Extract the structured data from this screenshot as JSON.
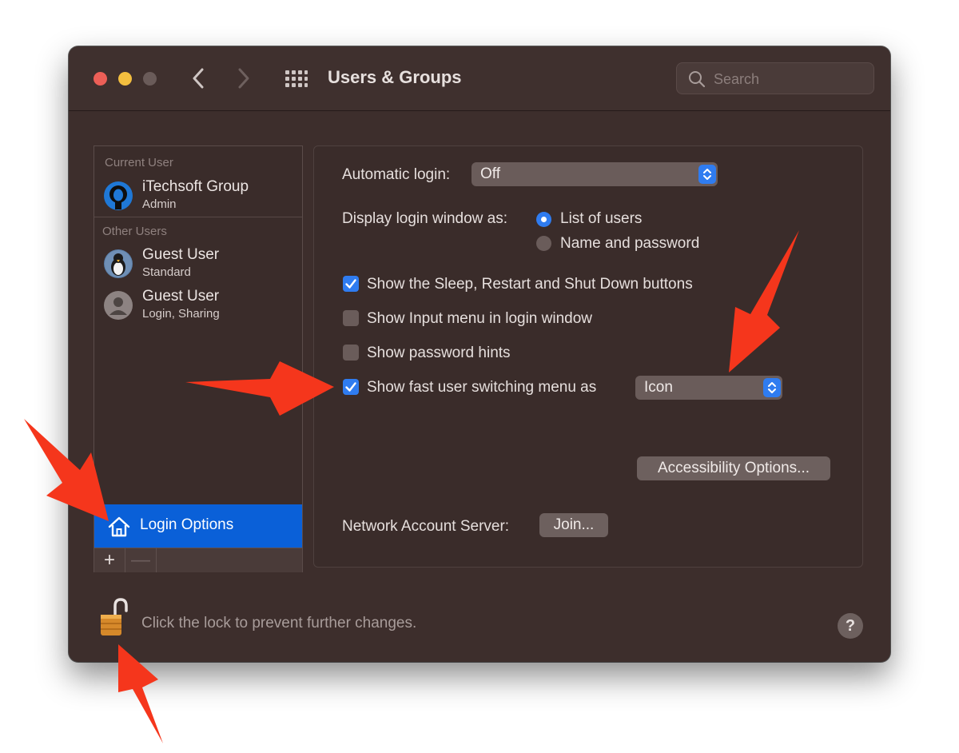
{
  "window": {
    "title": "Users & Groups"
  },
  "search": {
    "placeholder": "Search"
  },
  "sidebar": {
    "current_user_label": "Current User",
    "other_users_label": "Other Users",
    "users": [
      {
        "name": "iTechsoft Group",
        "role": "Admin",
        "avatar": "user-avatar-icon"
      },
      {
        "name": "Guest User",
        "role": "Standard",
        "avatar": "penguin-avatar-icon"
      },
      {
        "name": "Guest User",
        "role": "Login, Sharing",
        "avatar": "person-silhouette-icon"
      }
    ],
    "login_options_label": "Login Options",
    "add_label": "+",
    "remove_label": "—"
  },
  "settings": {
    "auto_login_label": "Automatic login:",
    "auto_login_value": "Off",
    "display_login_label": "Display login window as:",
    "radio_options": [
      {
        "label": "List of users",
        "selected": true
      },
      {
        "label": "Name and password",
        "selected": false
      }
    ],
    "checkboxes": [
      {
        "label": "Show the Sleep, Restart and Shut Down buttons",
        "checked": true
      },
      {
        "label": "Show Input menu in login window",
        "checked": false
      },
      {
        "label": "Show password hints",
        "checked": false
      },
      {
        "label": "Show fast user switching menu as",
        "checked": true
      }
    ],
    "fast_switch_value": "Icon",
    "accessibility_button": "Accessibility Options...",
    "network_server_label": "Network Account Server:",
    "join_button": "Join..."
  },
  "footer": {
    "lock_text": "Click the lock to prevent further changes.",
    "help_label": "?"
  },
  "colors": {
    "window_bg": "#3d2e2c",
    "accent": "#2f7cf0",
    "selection": "#0a60d8",
    "annotation_arrow": "#f5361c"
  }
}
